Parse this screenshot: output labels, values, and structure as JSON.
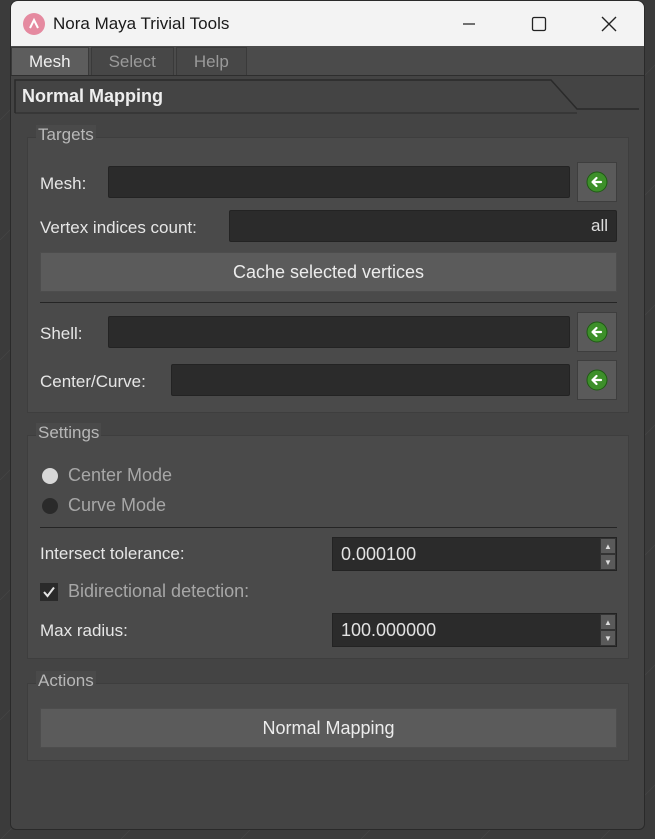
{
  "window": {
    "title": "Nora Maya Trivial Tools"
  },
  "menu": {
    "tabs": [
      "Mesh",
      "Select",
      "Help"
    ]
  },
  "panel": {
    "title": "Normal Mapping"
  },
  "targets": {
    "title": "Targets",
    "mesh_label": "Mesh:",
    "mesh_value": "",
    "vertex_count_label": "Vertex indices count:",
    "vertex_count_value": "all",
    "cache_button": "Cache selected vertices",
    "shell_label": "Shell:",
    "shell_value": "",
    "center_label": "Center/Curve:",
    "center_value": ""
  },
  "settings": {
    "title": "Settings",
    "mode_options": [
      "Center Mode",
      "Curve Mode"
    ],
    "selected_mode": "Center Mode",
    "intersect_label": "Intersect tolerance:",
    "intersect_value": "0.000100",
    "bidirectional_label": "Bidirectional detection:",
    "bidirectional_checked": true,
    "max_radius_label": "Max radius:",
    "max_radius_value": "100.000000"
  },
  "actions": {
    "title": "Actions",
    "normal_mapping_button": "Normal Mapping"
  },
  "colors": {
    "panel_bg": "#444444",
    "field_bg": "#2b2b2b",
    "button_bg": "#5b5b5b",
    "arrow_icon": "#3d8f2a"
  }
}
